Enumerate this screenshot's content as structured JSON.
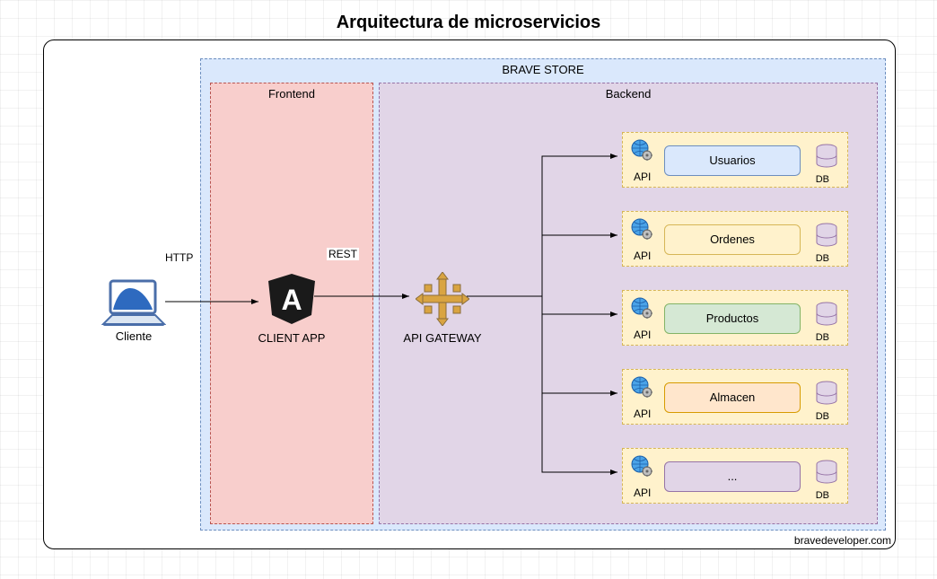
{
  "title": "Arquitectura de microservicios",
  "watermark": "bravedeveloper.com",
  "client_label": "Cliente",
  "containers": {
    "brave_store": "BRAVE STORE",
    "frontend": "Frontend",
    "backend": "Backend"
  },
  "client_app_label": "CLIENT APP",
  "api_gateway_label": "API GATEWAY",
  "edges": {
    "client_to_app": "HTTP",
    "app_to_gateway": "REST"
  },
  "api_label": "API",
  "db_label": "DB",
  "services": [
    {
      "name": "Usuarios",
      "color": "blue"
    },
    {
      "name": "Ordenes",
      "color": "yellow"
    },
    {
      "name": "Productos",
      "color": "green"
    },
    {
      "name": "Almacen",
      "color": "orange"
    },
    {
      "name": "...",
      "color": "purple"
    }
  ]
}
